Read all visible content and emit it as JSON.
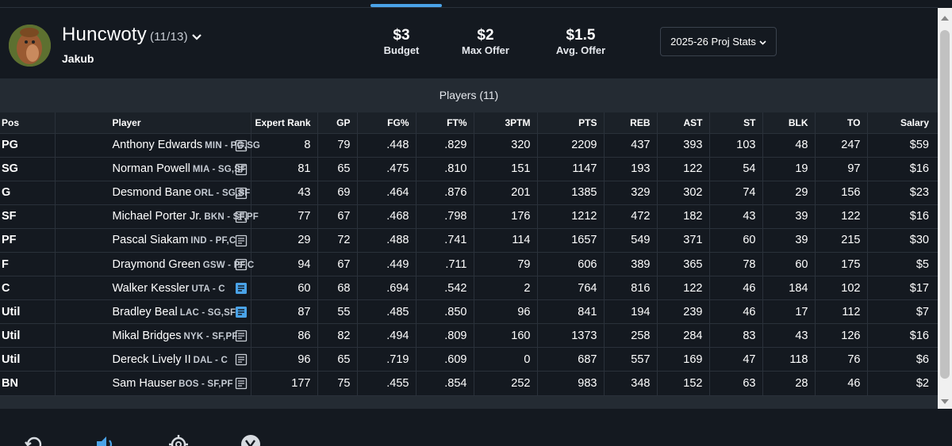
{
  "header": {
    "team_name": "Huncwoty",
    "team_record": "(11/13)",
    "owner": "Jakub",
    "avatar_icon": "monkey-avatar-icon",
    "stats": [
      {
        "value": "$3",
        "label": "Budget"
      },
      {
        "value": "$2",
        "label": "Max Offer"
      },
      {
        "value": "$1.5",
        "label": "Avg. Offer"
      }
    ],
    "proj_select": "2025-26 Proj Stats"
  },
  "players_title": "Players (11)",
  "columns": [
    "Pos",
    "Player",
    "Expert Rank",
    "GP",
    "FG%",
    "FT%",
    "3PTM",
    "PTS",
    "REB",
    "AST",
    "ST",
    "BLK",
    "TO",
    "Salary"
  ],
  "rows": [
    {
      "pos": "PG",
      "name": "Anthony Edwards",
      "meta": "MIN - PG,SG",
      "note_active": false,
      "rank": "8",
      "gp": "79",
      "fg": ".448",
      "ft": ".829",
      "tpm": "320",
      "pts": "2209",
      "reb": "437",
      "ast": "393",
      "st": "103",
      "blk": "48",
      "to": "247",
      "salary": "$59"
    },
    {
      "pos": "SG",
      "name": "Norman Powell",
      "meta": "MIA - SG,SF",
      "note_active": false,
      "rank": "81",
      "gp": "65",
      "fg": ".475",
      "ft": ".810",
      "tpm": "151",
      "pts": "1147",
      "reb": "193",
      "ast": "122",
      "st": "54",
      "blk": "19",
      "to": "97",
      "salary": "$16"
    },
    {
      "pos": "G",
      "name": "Desmond Bane",
      "meta": "ORL - SG,SF",
      "note_active": false,
      "rank": "43",
      "gp": "69",
      "fg": ".464",
      "ft": ".876",
      "tpm": "201",
      "pts": "1385",
      "reb": "329",
      "ast": "302",
      "st": "74",
      "blk": "29",
      "to": "156",
      "salary": "$23"
    },
    {
      "pos": "SF",
      "name": "Michael Porter Jr.",
      "meta": "BKN - SF,PF",
      "note_active": false,
      "rank": "77",
      "gp": "67",
      "fg": ".468",
      "ft": ".798",
      "tpm": "176",
      "pts": "1212",
      "reb": "472",
      "ast": "182",
      "st": "43",
      "blk": "39",
      "to": "122",
      "salary": "$16"
    },
    {
      "pos": "PF",
      "name": "Pascal Siakam",
      "meta": "IND - PF,C",
      "note_active": false,
      "rank": "29",
      "gp": "72",
      "fg": ".488",
      "ft": ".741",
      "tpm": "114",
      "pts": "1657",
      "reb": "549",
      "ast": "371",
      "st": "60",
      "blk": "39",
      "to": "215",
      "salary": "$30"
    },
    {
      "pos": "F",
      "name": "Draymond Green",
      "meta": "GSW - PF,C",
      "note_active": false,
      "rank": "94",
      "gp": "67",
      "fg": ".449",
      "ft": ".711",
      "tpm": "79",
      "pts": "606",
      "reb": "389",
      "ast": "365",
      "st": "78",
      "blk": "60",
      "to": "175",
      "salary": "$5"
    },
    {
      "pos": "C",
      "name": "Walker Kessler",
      "meta": "UTA - C",
      "note_active": true,
      "rank": "60",
      "gp": "68",
      "fg": ".694",
      "ft": ".542",
      "tpm": "2",
      "pts": "764",
      "reb": "816",
      "ast": "122",
      "st": "46",
      "blk": "184",
      "to": "102",
      "salary": "$17"
    },
    {
      "pos": "Util",
      "name": "Bradley Beal",
      "meta": "LAC - SG,SF",
      "note_active": true,
      "rank": "87",
      "gp": "55",
      "fg": ".485",
      "ft": ".850",
      "tpm": "96",
      "pts": "841",
      "reb": "194",
      "ast": "239",
      "st": "46",
      "blk": "17",
      "to": "112",
      "salary": "$7"
    },
    {
      "pos": "Util",
      "name": "Mikal Bridges",
      "meta": "NYK - SF,PF",
      "note_active": false,
      "rank": "86",
      "gp": "82",
      "fg": ".494",
      "ft": ".809",
      "tpm": "160",
      "pts": "1373",
      "reb": "258",
      "ast": "284",
      "st": "83",
      "blk": "43",
      "to": "126",
      "salary": "$16"
    },
    {
      "pos": "Util",
      "name": "Dereck Lively II",
      "meta": "DAL - C",
      "note_active": false,
      "rank": "96",
      "gp": "65",
      "fg": ".719",
      "ft": ".609",
      "tpm": "0",
      "pts": "687",
      "reb": "557",
      "ast": "169",
      "st": "47",
      "blk": "118",
      "to": "76",
      "salary": "$6"
    },
    {
      "pos": "BN",
      "name": "Sam Hauser",
      "meta": "BOS - SF,PF",
      "note_active": false,
      "rank": "177",
      "gp": "75",
      "fg": ".455",
      "ft": ".854",
      "tpm": "252",
      "pts": "983",
      "reb": "348",
      "ast": "152",
      "st": "63",
      "blk": "28",
      "to": "46",
      "salary": "$2"
    }
  ],
  "colors": {
    "background": "#141920",
    "panel": "#242b33",
    "accent": "#4aa3e8",
    "note_active": "#4aa3e8",
    "note_inactive": "#c9ced5"
  },
  "bottom_icons": [
    "refresh-icon",
    "sound-icon",
    "settings-icon",
    "yahoo-icon"
  ]
}
